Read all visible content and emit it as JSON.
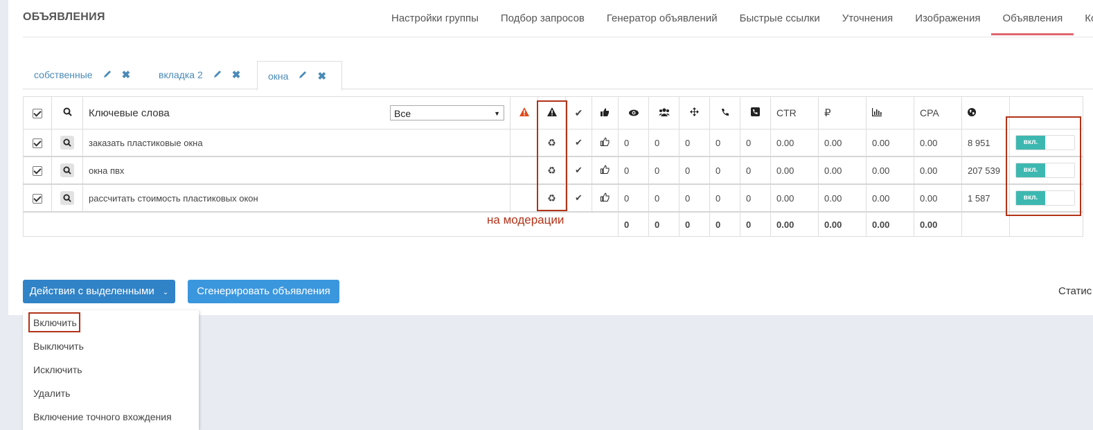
{
  "header": {
    "title": "ОБЪЯВЛЕНИЯ"
  },
  "nav": [
    {
      "label": "Настройки группы"
    },
    {
      "label": "Подбор запросов"
    },
    {
      "label": "Генератор объявлений"
    },
    {
      "label": "Быстрые ссылки"
    },
    {
      "label": "Уточнения"
    },
    {
      "label": "Изображения"
    },
    {
      "label": "Объявления",
      "active": true
    },
    {
      "label": "Ко"
    }
  ],
  "tabs": [
    {
      "label": "собственные"
    },
    {
      "label": "вкладка 2"
    },
    {
      "label": "окна",
      "active": true
    }
  ],
  "table": {
    "keyword_header": "Ключевые слова",
    "filter_select": "Все",
    "metric_headers": {
      "ctr": "CTR",
      "rub": "₽",
      "cpa": "CPA"
    },
    "rows": [
      {
        "keyword": "заказать пластиковые окна",
        "m": [
          "0",
          "0",
          "0",
          "0",
          "0"
        ],
        "ctr": "0.00",
        "rub": "0.00",
        "stat": "0.00",
        "cpa": "0.00",
        "freq": "8 951",
        "status": "вкл."
      },
      {
        "keyword": "окна пвх",
        "m": [
          "0",
          "0",
          "0",
          "0",
          "0"
        ],
        "ctr": "0.00",
        "rub": "0.00",
        "stat": "0.00",
        "cpa": "0.00",
        "freq": "207 539",
        "status": "вкл."
      },
      {
        "keyword": "рассчитать стоимость пластиковых окон",
        "m": [
          "0",
          "0",
          "0",
          "0",
          "0"
        ],
        "ctr": "0.00",
        "rub": "0.00",
        "stat": "0.00",
        "cpa": "0.00",
        "freq": "1 587",
        "status": "вкл."
      }
    ],
    "totals": {
      "m": [
        "0",
        "0",
        "0",
        "0",
        "0"
      ],
      "ctr": "0.00",
      "rub": "0.00",
      "stat": "0.00",
      "cpa": "0.00"
    }
  },
  "annotation": "на модерации",
  "buttons": {
    "actions": "Действия с выделенными",
    "generate": "Сгенерировать объявления"
  },
  "stats_link": "Статис",
  "menu": [
    "Включить",
    "Выключить",
    "Исключить",
    "Удалить",
    "Включение точного вхождения"
  ],
  "colors": {
    "accent": "#3183c7",
    "annotation": "#b23218",
    "toggle_on": "#3db8b0",
    "warning": "#e04a1a"
  }
}
